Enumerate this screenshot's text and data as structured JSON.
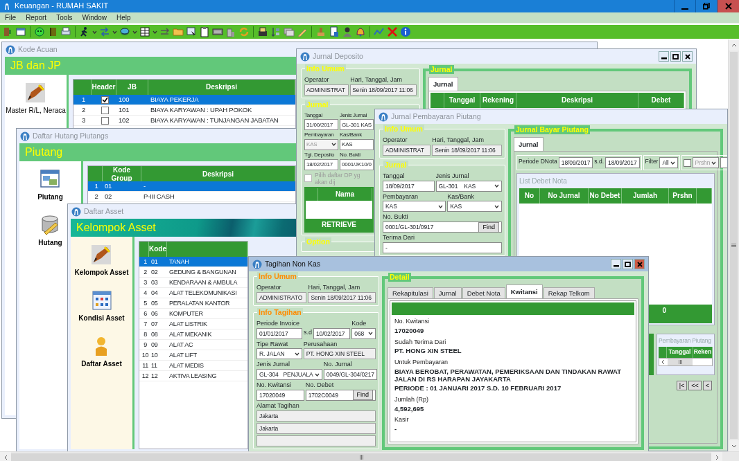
{
  "app": {
    "title": "Keuangan - RUMAH SAKIT",
    "menu": [
      "File",
      "Report",
      "Tools",
      "Window",
      "Help"
    ]
  },
  "windows": [
    {
      "kind": "launcher",
      "title": "Kode Acuan",
      "active": false,
      "banner": "JB dan JP",
      "launchers": [
        "Master R/L, Neraca"
      ],
      "grid": {
        "columns": [
          "Header",
          "JB",
          "Deskripsi"
        ],
        "rows": [
          {
            "no": "1",
            "header": true,
            "code": "100",
            "desc": "BIAYA PEKERJA",
            "selected": true
          },
          {
            "no": "2",
            "header": false,
            "code": "101",
            "desc": "BIAYA KARYAWAN : UPAH POKOK",
            "selected": false
          },
          {
            "no": "3",
            "header": false,
            "code": "102",
            "desc": "BIAYA KARYAWAN : TUNJANGAN JABATAN",
            "selected": false
          }
        ]
      }
    },
    {
      "kind": "launcher",
      "title": "Daftar Hutang Piutangs",
      "active": false,
      "banner": "Piutang",
      "launchers": [
        "Piutang",
        "Hutang"
      ],
      "grid": {
        "columns": [
          "Kode Group",
          "Deskripsi"
        ],
        "rows": [
          {
            "no": "1",
            "code": "01",
            "desc": "-",
            "selected": true
          },
          {
            "no": "2",
            "code": "02",
            "desc": "P-III CASH",
            "selected": false
          }
        ]
      }
    },
    {
      "kind": "launcher",
      "title": "Daftar Asset",
      "active": false,
      "banner": "Kelompok Asset",
      "launchers": [
        "Kelompok Asset",
        "Kondisi Asset",
        "Daftar Asset"
      ],
      "grid": {
        "columns": [
          "Kode"
        ],
        "rows": [
          {
            "no": "1",
            "code": "01",
            "desc": "TANAH",
            "selected": true
          },
          {
            "no": "2",
            "code": "02",
            "desc": "GEDUNG & BANGUNAN",
            "selected": false
          },
          {
            "no": "3",
            "code": "03",
            "desc": "KENDARAAN & AMBULA",
            "selected": false
          },
          {
            "no": "4",
            "code": "04",
            "desc": "ALAT TELEKOMUNIKASI",
            "selected": false
          },
          {
            "no": "5",
            "code": "05",
            "desc": "PERALATAN KANTOR",
            "selected": false
          },
          {
            "no": "6",
            "code": "06",
            "desc": "KOMPUTER",
            "selected": false
          },
          {
            "no": "7",
            "code": "07",
            "desc": "ALAT LISTRIK",
            "selected": false
          },
          {
            "no": "8",
            "code": "08",
            "desc": "ALAT MEKANIK",
            "selected": false
          },
          {
            "no": "9",
            "code": "09",
            "desc": "ALAT AC",
            "selected": false
          },
          {
            "no": "10",
            "code": "10",
            "desc": "ALAT LIFT",
            "selected": false
          },
          {
            "no": "11",
            "code": "11",
            "desc": "ALAT MEDIS",
            "selected": false
          },
          {
            "no": "12",
            "code": "12",
            "desc": "AKTIVA LEASING",
            "selected": false
          }
        ]
      }
    },
    {
      "kind": "form",
      "title": "Jurnal Deposito",
      "active": false,
      "left": [
        {
          "title": "Info Umum",
          "rows": [
            [
              {
                "kind": "text",
                "label": "Operator",
                "value": "ADMINISTRAT",
                "readonly": true
              },
              {
                "kind": "text",
                "label": "Hari, Tanggal, Jam",
                "value": "Senin 18/09/2017 11:06",
                "readonly": true
              }
            ]
          ]
        },
        {
          "title": "Jurnal",
          "rows": [
            [
              {
                "kind": "text",
                "label": "Tanggal",
                "value": "31/00/2017"
              },
              {
                "kind": "text",
                "label": "Jenis Jurnal",
                "value": "GL-301 KAS"
              }
            ],
            [
              {
                "kind": "select",
                "label": "Pembayaran",
                "value": "KAS",
                "disabled": true
              },
              {
                "kind": "text",
                "label": "Kas/Bank",
                "value": "KAS"
              }
            ],
            [
              {
                "kind": "text",
                "label": "Tgl. Deposito",
                "value": "18/02/2017"
              },
              {
                "kind": "text",
                "label": "No. Bukti",
                "value": "0001/JK10/0"
              }
            ],
            [
              {
                "kind": "check",
                "label": "Pilih daftar DP yg akan dij",
                "checked": false,
                "disabled": true
              }
            ],
            [
              {
                "kind": "table",
                "columns": [
                  "Nama"
                ],
                "button": "RETRIEVE"
              }
            ]
          ]
        },
        {
          "title": "Option"
        }
      ],
      "right": {
        "title": "Jurnal",
        "tabs": [
          {
            "label": "Jurnal",
            "selected": true
          }
        ],
        "grid": {
          "columns": [
            "Tanggal",
            "Rekening",
            "Deskripsi",
            "Debet"
          ]
        }
      }
    },
    {
      "kind": "form",
      "title": "Jurnal Pembayaran Piutang",
      "active": false,
      "left": [
        {
          "title": "Info Umum",
          "rows": [
            [
              {
                "kind": "text",
                "label": "Operator",
                "value": "ADMINISTRAT",
                "readonly": true
              },
              {
                "kind": "text",
                "label": "Hari, Tanggal, Jam",
                "value": "Senin 18/09/2017 11:06",
                "readonly": true
              }
            ]
          ]
        },
        {
          "title": "Jurnal",
          "rows": [
            [
              {
                "kind": "text",
                "label": "Tanggal",
                "value": "18/09/2017"
              },
              {
                "kind": "select",
                "label": "Jenis Jurnal",
                "value": "GL-301    KAS"
              }
            ],
            [
              {
                "kind": "select",
                "label": "Pembayaran",
                "value": "KAS"
              },
              {
                "kind": "select",
                "label": "Kas/Bank",
                "value": "KAS"
              }
            ],
            [
              {
                "kind": "find",
                "label": "No. Bukti",
                "value": "0001/GL-301/0917",
                "button": "Find"
              }
            ],
            [
              {
                "kind": "text",
                "label": "Terima Dari",
                "value": "-"
              }
            ]
          ]
        }
      ],
      "right": {
        "title": "Jurnal Bayar Piutang",
        "tabs": [
          {
            "label": "Jurnal",
            "selected": true
          }
        ],
        "filters": [
          [
            {
              "kind": "sep",
              "value": "Periode DNota"
            },
            {
              "kind": "text",
              "value": "18/09/2017"
            },
            {
              "kind": "sep",
              "value": "s.d."
            },
            {
              "kind": "text",
              "value": "18/09/2017"
            }
          ],
          [
            {
              "kind": "sep",
              "value": "Filter"
            },
            {
              "kind": "select",
              "value": "All"
            }
          ],
          [
            {
              "kind": "check",
              "checked": false
            },
            {
              "kind": "select",
              "value": "Prshn",
              "disabled": true
            },
            {
              "kind": "text"
            }
          ]
        ],
        "list": {
          "title": "List Debet Nota",
          "columns": [
            "No",
            "No Jurnal",
            "No Debet",
            "Jumlah",
            "Prshn"
          ],
          "total": "0"
        },
        "history": {
          "title": "Pembayaran Piutang",
          "columns": [
            "Tanggal",
            "Reken"
          ]
        },
        "pager": [
          "|<",
          "<<",
          "<"
        ]
      }
    },
    {
      "kind": "form",
      "title": "Tagihan Non Kas",
      "active": true,
      "left": [
        {
          "title": "Info Umum",
          "rows": [
            [
              {
                "kind": "text",
                "label": "Operator",
                "value": "ADMINISTRATO",
                "readonly": true
              },
              {
                "kind": "text",
                "label": "Hari, Tanggal, Jam",
                "value": "Senin 18/09/2017 11:06",
                "readonly": true
              }
            ]
          ]
        },
        {
          "title": "Info Tagihan",
          "rows": [
            [
              {
                "kind": "text",
                "label": "Periode Invoice",
                "value": "01/01/2017"
              },
              {
                "kind": "sep",
                "value": "s.d"
              },
              {
                "kind": "text",
                "value": "10/02/2017"
              },
              {
                "kind": "select",
                "label": "Kode",
                "value": "068"
              }
            ],
            [
              {
                "kind": "select",
                "label": "Tipe Rawat",
                "value": "R. JALAN"
              },
              {
                "kind": "text",
                "label": "Perusahaan",
                "value": "PT. HONG XIN STEEL",
                "readonly": true
              }
            ],
            [
              {
                "kind": "select",
                "label": "Jenis Jurnal",
                "value": "GL-304   PENJUALA"
              },
              {
                "kind": "text",
                "label": "No. Jurnal",
                "value": "0049/GL-304/0217"
              }
            ],
            [
              {
                "kind": "text",
                "label": "No. Kwitansi",
                "value": "17020049"
              },
              {
                "kind": "find",
                "label": "No. Debet",
                "value": "1702C0049",
                "button": "Find"
              }
            ],
            [
              {
                "kind": "text",
                "label": "Alamat Tagihan",
                "value": "Jakarta",
                "readonly": true
              }
            ],
            [
              {
                "kind": "text",
                "value": "Jakarta",
                "readonly": true
              }
            ],
            [
              {
                "kind": "text",
                "readonly": true
              }
            ]
          ]
        }
      ],
      "right": {
        "title": "Detail",
        "tabs": [
          {
            "label": "Rekapitulasi",
            "selected": false
          },
          {
            "label": "Jurnal",
            "selected": false
          },
          {
            "label": "Debet Nota",
            "selected": false
          },
          {
            "label": "Kwitansi",
            "selected": true
          },
          {
            "label": "Rekap Telkom",
            "selected": false
          }
        ],
        "receipt": [
          {
            "label": "No. Kwitansi",
            "lines": [
              "17020049"
            ]
          },
          {
            "label": "Sudah Terima Dari",
            "lines": [
              "PT. HONG XIN STEEL"
            ]
          },
          {
            "label": "Untuk Pembayaran",
            "lines": [
              "BIAYA BEROBAT, PERAWATAN, PEMERIKSAAN DAN TINDAKAN RAWAT JALAN DI RS HARAPAN JAYAKARTA",
              "PERIODE : 01 JANUARI 2017 S.D. 10 FEBRUARI 2017"
            ]
          },
          {
            "label": "Jumlah (Rp)",
            "lines": [
              "4,592,695"
            ]
          },
          {
            "label": "Kasir",
            "lines": [
              "-"
            ]
          }
        ]
      }
    }
  ]
}
